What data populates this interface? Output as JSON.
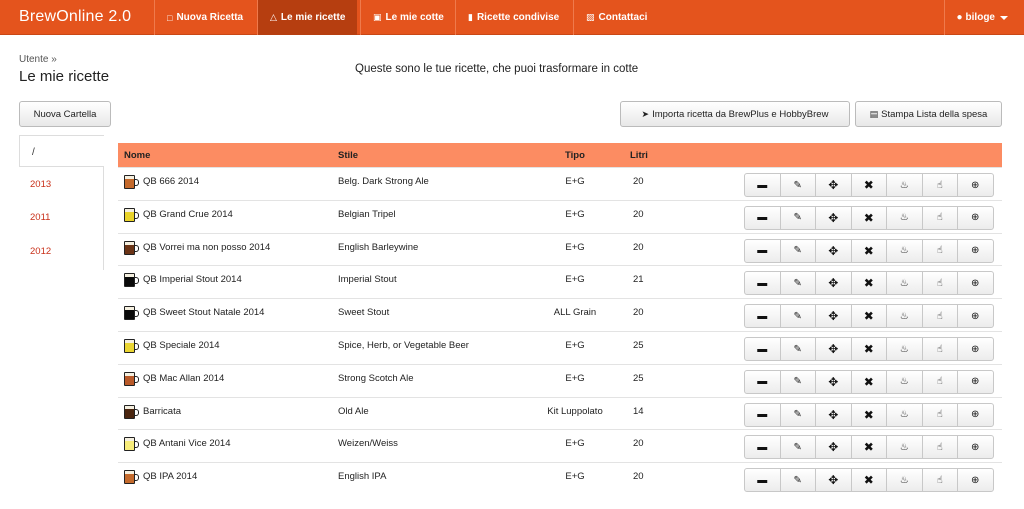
{
  "navbar": {
    "brand": "BrewOnline 2.0",
    "items": [
      {
        "label": "Nuova Ricetta",
        "icon": "clipboard-icon"
      },
      {
        "label": "Le mie ricette",
        "icon": "flask-icon"
      },
      {
        "label": "Le mie cotte",
        "icon": "glass-icon"
      },
      {
        "label": "Ricette condivise",
        "icon": "drink-icon"
      },
      {
        "label": "Contattaci",
        "icon": "inbox-icon"
      }
    ],
    "user": "biloge",
    "accent_color": "#e4541d",
    "active_color": "#b63e10"
  },
  "page": {
    "breadcrumb": "Utente »",
    "title": "Le mie ricette",
    "intro": "Queste sono le tue ricette, che puoi trasformare in cotte"
  },
  "buttons": {
    "new_folder": "Nuova Cartella",
    "import": "Importa ricetta da BrewPlus e HobbyBrew",
    "print": "Stampa Lista della spesa"
  },
  "folders": {
    "active": "/",
    "items": [
      "2013",
      "2011",
      "2012"
    ]
  },
  "table": {
    "header_color": "#fc8c62",
    "columns": [
      "Nome",
      "Stile",
      "Tipo",
      "Litri"
    ],
    "actions": [
      "folder-icon",
      "edit-icon",
      "move-icon",
      "delete-icon",
      "fire-icon",
      "thumbs-up-icon",
      "add-icon"
    ],
    "rows": [
      {
        "name": "QB 666 2014",
        "style": "Belg. Dark Strong Ale",
        "type": "E+G",
        "liters": "20",
        "color": "#c4692b"
      },
      {
        "name": "QB Grand Crue 2014",
        "style": "Belgian Tripel",
        "type": "E+G",
        "liters": "20",
        "color": "#e9d32a"
      },
      {
        "name": "QB Vorrei ma non posso 2014",
        "style": "English Barleywine",
        "type": "E+G",
        "liters": "20",
        "color": "#6b3416"
      },
      {
        "name": "QB Imperial Stout 2014",
        "style": "Imperial Stout",
        "type": "E+G",
        "liters": "21",
        "color": "#0a0a0a"
      },
      {
        "name": "QB Sweet Stout Natale 2014",
        "style": "Sweet Stout",
        "type": "ALL Grain",
        "liters": "20",
        "color": "#0a0a0a"
      },
      {
        "name": "QB Speciale 2014",
        "style": "Spice, Herb, or Vegetable Beer",
        "type": "E+G",
        "liters": "25",
        "color": "#ead532"
      },
      {
        "name": "QB Mac Allan 2014",
        "style": "Strong Scotch Ale",
        "type": "E+G",
        "liters": "25",
        "color": "#b95a29"
      },
      {
        "name": "Barricata",
        "style": "Old Ale",
        "type": "Kit Luppolato",
        "liters": "14",
        "color": "#4a250f"
      },
      {
        "name": "QB Antani Vice 2014",
        "style": "Weizen/Weiss",
        "type": "E+G",
        "liters": "20",
        "color": "#f7ec7a"
      },
      {
        "name": "QB IPA 2014",
        "style": "English IPA",
        "type": "E+G",
        "liters": "20",
        "color": "#c46a2c"
      }
    ]
  }
}
